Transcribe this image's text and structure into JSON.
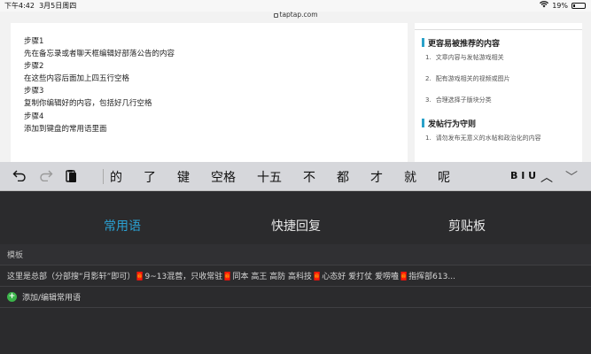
{
  "status": {
    "time": "下午4:42",
    "date": "3月5日周四",
    "battery": "19%",
    "battery_level": 0.19,
    "url": "taptap.com"
  },
  "article": {
    "lines": [
      "步骤1",
      "先在备忘录或者聊天框编辑好部落公告的内容",
      "步骤2",
      "在这些内容后面加上四五行空格",
      "步骤3",
      "复制你编辑好的内容，包括好几行空格",
      "步骤4",
      "添加到键盘的常用语里面"
    ]
  },
  "sidebar": {
    "section1_title": "更容易被推荐的内容",
    "section1_items": [
      {
        "num": "1.",
        "text": "文章内容与发帖游戏相关"
      },
      {
        "num": "2.",
        "text": "配有游戏相关的视频或图片"
      },
      {
        "num": "3.",
        "text": "合理选择子版块分类"
      }
    ],
    "section2_title": "发帖行为守则",
    "section2_items": [
      {
        "num": "1.",
        "text": "请勿发布无意义的水帖和政治化的内容"
      }
    ]
  },
  "toolbar": {
    "undo_icon": "undo-arrow",
    "redo_icon": "redo-arrow",
    "paste_icon": "clipboard-paste",
    "candidates": [
      "的",
      "了",
      "键",
      "空格",
      "十五",
      "不",
      "都",
      "才",
      "就",
      "呢"
    ],
    "format_label": "B I U",
    "up_arrow": "︿",
    "down_arrow": "﹀"
  },
  "panel": {
    "tabs": [
      "常用语",
      "快捷回复",
      "剪贴板"
    ],
    "active_tab": 0,
    "category": "模板",
    "phrase": "这里是总部（分部搜“月影轩”即可）🧧9~13混营，只收常驻🧧同本 高王 高防 高科技🧧心态好 爱打仗 爱唠嗑🧧指挥部613...",
    "add_label": "添加/编辑常用语",
    "accent_color": "#2ba1d3",
    "add_color": "#3bb54a"
  }
}
